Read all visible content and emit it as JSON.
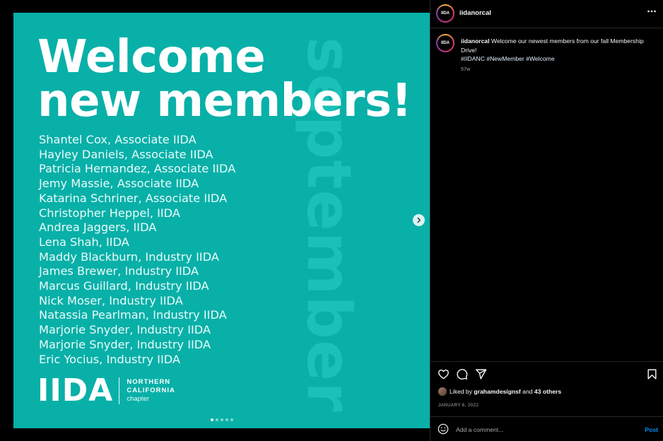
{
  "image": {
    "headline_line1": "Welcome",
    "headline_line2": "new members!",
    "vertical_word": "september",
    "members": [
      "Shantel Cox, Associate IIDA",
      "Hayley Daniels, Associate IIDA",
      "Patricia Hernandez, Associate IIDA",
      "Jemy Massie, Associate IIDA",
      "Katarina Schriner, Associate IIDA",
      "Christopher Heppel, IIDA",
      "Andrea Jaggers, IIDA",
      "Lena Shah, IIDA",
      "Maddy Blackburn, Industry IIDA",
      "James Brewer, Industry IIDA",
      "Marcus Guillard, Industry IIDA",
      "Nick Moser, Industry IIDA",
      "Natassia Pearlman, Industry IIDA",
      "Marjorie Snyder, Industry IIDA",
      "Marjorie Snyder, Industry IIDA",
      "Eric Yocius, Industry IIDA"
    ],
    "logo": {
      "mark": "IIDA",
      "line1": "NORTHERN",
      "line2": "CALIFORNIA",
      "line3": "chapter"
    },
    "carousel": {
      "total": 5,
      "active_index": 0
    },
    "background_color": "#08b0a8"
  },
  "header": {
    "avatar_label": "IIDA",
    "username": "iidanorcal",
    "more_icon": "more-horizontal-icon"
  },
  "caption": {
    "username": "iidanorcal",
    "text": "Welcome our newest members from our fall Membership Drive!",
    "hashtags": "#IIDANC #NewMember #Welcome",
    "time_ago": "57w"
  },
  "actions": {
    "icons": [
      "heart-icon",
      "comment-icon",
      "share-icon",
      "bookmark-icon"
    ]
  },
  "likes": {
    "prefix": "Liked by ",
    "user": "grahamdesignsf",
    "middle": " and ",
    "others": "43 others"
  },
  "date": "JANUARY 6, 2022",
  "comment_box": {
    "placeholder": "Add a comment...",
    "post_label": "Post"
  },
  "colors": {
    "accent_blue": "#0095f6",
    "panel_bg": "#000000",
    "divider": "#262626"
  }
}
